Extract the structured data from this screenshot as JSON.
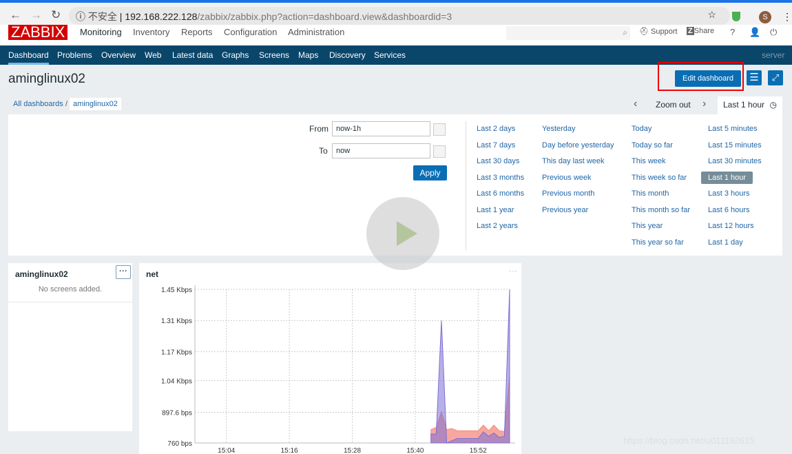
{
  "browser": {
    "insecure_label": "不安全",
    "url_host": "192.168.222.128",
    "url_path": "/zabbix/zabbix.php?action=dashboard.view&dashboardid=3",
    "profile_initial": "S"
  },
  "header": {
    "logo": "ZABBIX",
    "menu": [
      "Monitoring",
      "Inventory",
      "Reports",
      "Configuration",
      "Administration"
    ],
    "support": "Support",
    "share": "Share",
    "help": "?"
  },
  "submenu": {
    "items": [
      "Dashboard",
      "Problems",
      "Overview",
      "Web",
      "Latest data",
      "Graphs",
      "Screens",
      "Maps",
      "Discovery",
      "Services"
    ],
    "server": "server"
  },
  "page": {
    "title": "aminglinux02",
    "edit_button": "Edit dashboard"
  },
  "breadcrumb": {
    "all": "All dashboards",
    "sep": "/",
    "current": "aminglinux02"
  },
  "timebar": {
    "zoom_out": "Zoom out",
    "current": "Last 1 hour"
  },
  "timepicker": {
    "from_label": "From",
    "from_value": "now-1h",
    "to_label": "To",
    "to_value": "now",
    "apply": "Apply",
    "columns": [
      [
        "Last 2 days",
        "Last 7 days",
        "Last 30 days",
        "Last 3 months",
        "Last 6 months",
        "Last 1 year",
        "Last 2 years"
      ],
      [
        "Yesterday",
        "Day before yesterday",
        "This day last week",
        "Previous week",
        "Previous month",
        "Previous year"
      ],
      [
        "Today",
        "Today so far",
        "This week",
        "This week so far",
        "This month",
        "This month so far",
        "This year",
        "This year so far"
      ],
      [
        "Last 5 minutes",
        "Last 15 minutes",
        "Last 30 minutes",
        "Last 1 hour",
        "Last 3 hours",
        "Last 6 hours",
        "Last 12 hours",
        "Last 1 day"
      ]
    ],
    "selected": "Last 1 hour"
  },
  "widgets": {
    "screens": {
      "title": "aminglinux02",
      "empty": "No screens added."
    },
    "graph": {
      "title": "net"
    }
  },
  "watermark": "https://blog.csdn.net/u011192615",
  "chart_data": {
    "type": "area",
    "ylim": [
      760,
      1450
    ],
    "yticks": [
      "1.45 Kbps",
      "1.31 Kbps",
      "1.17 Kbps",
      "1.04 Kbps",
      "897.6 bps",
      "760 bps"
    ],
    "ytick_values": [
      1450,
      1310,
      1170,
      1040,
      897.6,
      760
    ],
    "xticks": [
      "15:04",
      "15:16",
      "15:28",
      "15:40",
      "15:52"
    ],
    "xlim": [
      "14:58",
      "15:58"
    ],
    "grid": true,
    "series": [
      {
        "color": "#f48a7c",
        "x": [
          "15:43",
          "15:44",
          "15:45",
          "15:46",
          "15:47",
          "15:48",
          "15:52",
          "15:53",
          "15:54",
          "15:55",
          "15:56",
          "15:57",
          "15:58"
        ],
        "values": [
          820,
          830,
          900,
          820,
          825,
          815,
          815,
          840,
          815,
          840,
          815,
          812,
          1060
        ]
      },
      {
        "color": "#7b6fd6",
        "x": [
          "15:43",
          "15:44",
          "15:45",
          "15:46",
          "15:48",
          "15:52",
          "15:53",
          "15:54",
          "15:55",
          "15:56",
          "15:57",
          "15:58"
        ],
        "values": [
          800,
          800,
          1310,
          760,
          780,
          780,
          810,
          790,
          805,
          785,
          790,
          1450
        ]
      }
    ]
  }
}
